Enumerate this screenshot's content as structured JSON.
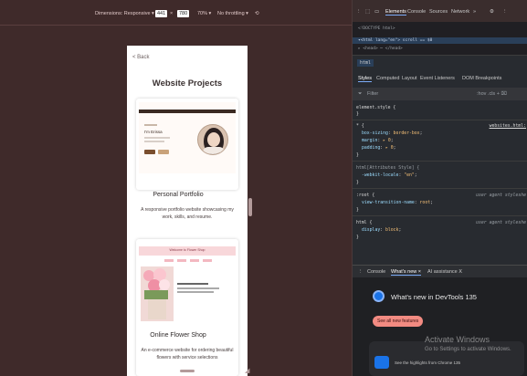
{
  "toolbar": {
    "dimensions_label": "Dimensions: Responsive ▾",
    "width": "441",
    "times": "×",
    "height": "780",
    "zoom": "70% ▾",
    "throttling": "No throttling ▾"
  },
  "page": {
    "back_link": "< Back",
    "title": "Website Projects",
    "projects": [
      {
        "title": "Personal Portfolio",
        "description": "A responsive portfolio website showcasing my work, skills, and resume.",
        "thumb_heading": "I'm Erissa"
      },
      {
        "title": "Online Flower Shop",
        "description": "An e-commerce website for ordering beautiful flowers with service selections",
        "thumb_heading": "Welcome to Flower Shop"
      }
    ]
  },
  "devtools": {
    "tabs": [
      "Elements",
      "Console",
      "Sources",
      "Network",
      "»"
    ],
    "dom_lines": [
      "<!DOCTYPE html>",
      "▾<html lang=\"en\"> scroll == $0",
      "  ▸ <head> ⋯ </head>"
    ],
    "breadcrumb": "html",
    "style_tabs": [
      "Styles",
      "Computed",
      "Layout",
      "Event Listeners",
      "DOM Breakpoints"
    ],
    "filter_placeholder": "Filter",
    "filter_tools": ":hov .cls + ⌧",
    "rules": [
      {
        "selector": "element.style {",
        "props": [],
        "source": ""
      },
      {
        "selector": "* {",
        "props": [
          [
            "box-sizing",
            "border-box"
          ],
          [
            "margin",
            "▸ 0"
          ],
          [
            "padding",
            "▸ 0"
          ]
        ],
        "source": "websites.html:"
      },
      {
        "selector": "html[Attributes Style] {",
        "props": [
          [
            "-webkit-locale",
            "\"en\""
          ]
        ],
        "source": ""
      },
      {
        "selector": ":root {",
        "props": [
          [
            "view-transition-name",
            "root"
          ]
        ],
        "source": "user agent styleshe"
      },
      {
        "selector": "html {",
        "props": [
          [
            "display",
            "block"
          ]
        ],
        "source": "user agent styleshe"
      }
    ],
    "drawer_tabs": [
      "Console",
      "What's new ×",
      "AI assistance Ⅹ"
    ],
    "whats_new_title": "What's new in DevTools 135",
    "see_all_button": "See all new features",
    "highlights_text": "See the highlights from Chrome 135"
  },
  "overlay": {
    "activate_title": "Activate Windows",
    "activate_sub": "Go to Settings to activate Windows."
  },
  "colors": {
    "page_bg": "#3f2a2a",
    "devtools_bg": "#282b30",
    "accent": "#7cacf8",
    "button_pink": "#f28b82"
  }
}
